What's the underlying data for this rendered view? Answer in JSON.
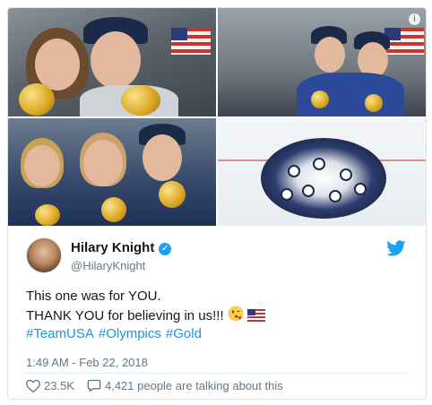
{
  "tweet": {
    "author_name": "Hilary Knight",
    "handle": "@HilaryKnight",
    "lines": [
      "This one was for YOU.",
      "THANK YOU for believing in us!!!"
    ],
    "hashtags": [
      "#TeamUSA",
      "#Olympics",
      "#Gold"
    ],
    "timestamp": "1:49 AM - Feb 22, 2018",
    "likes": "23.5K",
    "talking": "4,421 people are talking about this"
  },
  "icons": {
    "info": "info-icon",
    "verified": "verified-badge-icon",
    "brand": "twitter-bird-icon",
    "like": "heart-icon",
    "reply": "speech-bubble-icon",
    "emoji_1": "kissing-face-emoji",
    "emoji_2": "us-flag-emoji"
  },
  "colors": {
    "link": "#1b95e0",
    "verified": "#1da1f2",
    "text": "#14171a",
    "muted": "#657786"
  }
}
